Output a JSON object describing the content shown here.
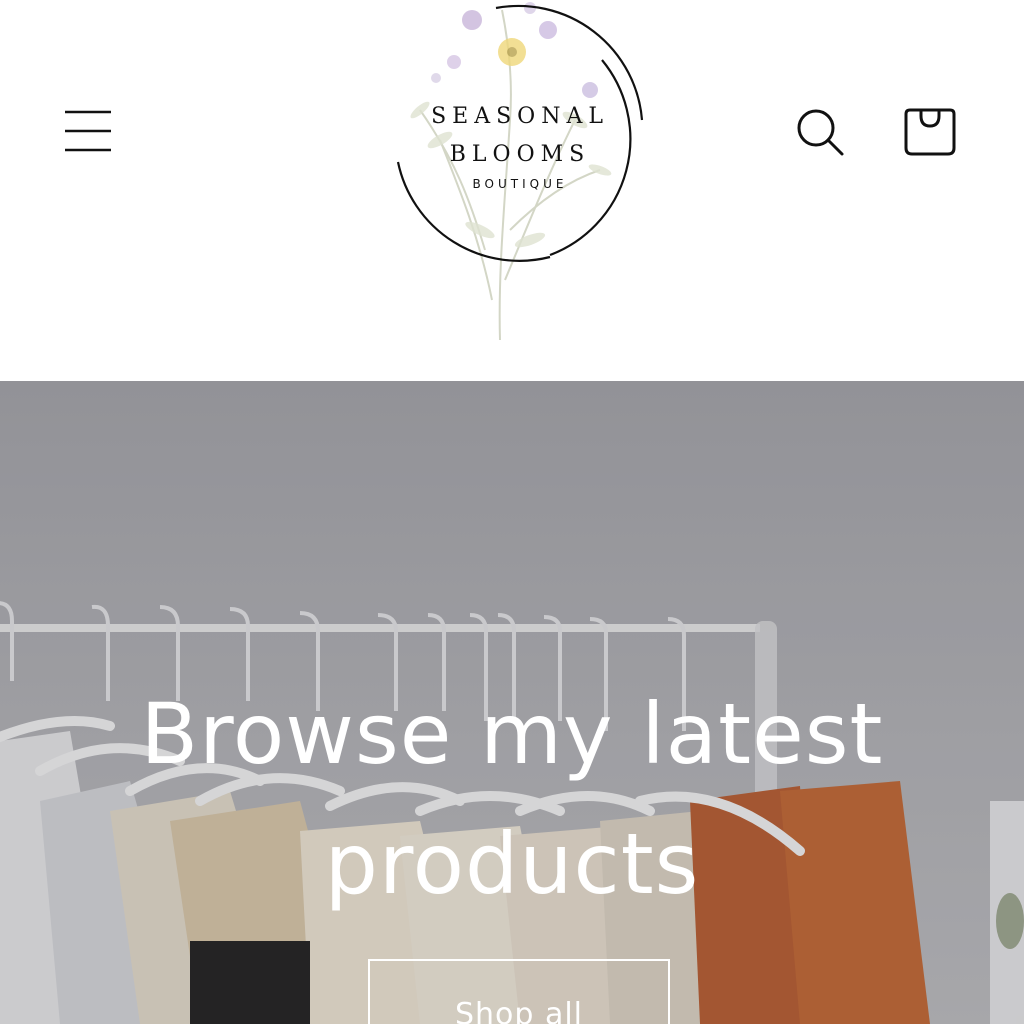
{
  "header": {
    "brand": {
      "line1": "SEASONAL",
      "line2": "BLOOMS",
      "line3": "BOUTIQUE"
    },
    "icons": {
      "menu": "hamburger-menu-icon",
      "search": "search-icon",
      "cart": "cart-bag-icon"
    }
  },
  "hero": {
    "title": "Browse my latest products",
    "button_label": "Shop all"
  },
  "colors": {
    "header_bg": "#ffffff",
    "hero_text": "#ffffff",
    "icon": "#111111",
    "wall": "#a9a9ad",
    "rust_garment": "#b85a2c"
  }
}
